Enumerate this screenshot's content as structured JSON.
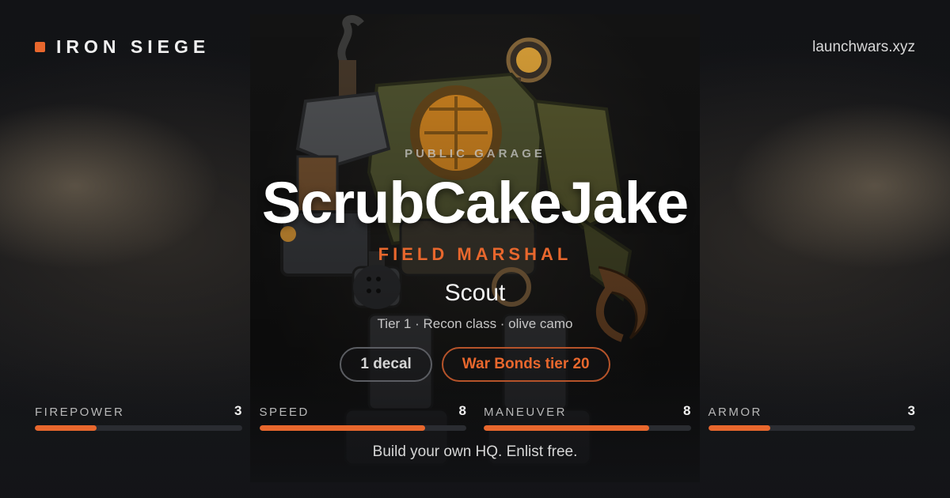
{
  "brand": {
    "name": "IRON SIEGE",
    "site": "launchwars.xyz"
  },
  "profile": {
    "eyebrow": "PUBLIC GARAGE",
    "player": "ScrubCakeJake",
    "rank": "FIELD MARSHAL",
    "vehicle": "Scout",
    "description": "Tier 1 · Recon class · olive camo"
  },
  "pills": [
    {
      "label": "1 decal",
      "style": "gray"
    },
    {
      "label": "War Bonds tier 20",
      "style": "orange"
    }
  ],
  "stats": [
    {
      "label": "FIREPOWER",
      "value": "3",
      "level": 0.3
    },
    {
      "label": "SPEED",
      "value": "8",
      "level": 0.8
    },
    {
      "label": "MANEUVER",
      "value": "8",
      "level": 0.8
    },
    {
      "label": "ARMOR",
      "value": "3",
      "level": 0.3
    }
  ],
  "cta": "Build your own HQ. Enlist free.",
  "colors": {
    "accent": "#e8672d",
    "background": "#131417",
    "bar_track": "#2a2c31"
  },
  "hero": {
    "image": "steampunk-mech-illustration"
  }
}
